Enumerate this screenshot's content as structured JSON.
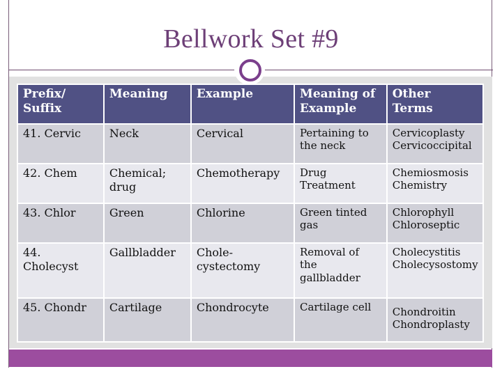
{
  "slide": {
    "title": "Bellwork Set #9",
    "accent_color": "#6d3f77",
    "header_color": "#505184",
    "footer_color": "#9c4d9f"
  },
  "table": {
    "headers": [
      [
        "Prefix/",
        "Suffix"
      ],
      [
        "Meaning"
      ],
      [
        "Example"
      ],
      [
        "Meaning of",
        "Example"
      ],
      [
        "Other",
        "Terms"
      ]
    ],
    "rows": [
      {
        "prefix": [
          "41. Cervic"
        ],
        "meaning": [
          "Neck"
        ],
        "example": [
          "Cervical"
        ],
        "meaning_of_example": [
          "Pertaining to",
          "the neck"
        ],
        "other_terms": [
          "Cervicoplasty",
          "Cervicoccipital"
        ]
      },
      {
        "prefix": [
          "42. Chem"
        ],
        "meaning": [
          "Chemical;",
          "drug"
        ],
        "example": [
          "Chemotherapy"
        ],
        "meaning_of_example": [
          "Drug",
          "Treatment"
        ],
        "other_terms": [
          "Chemiosmosis",
          "Chemistry"
        ]
      },
      {
        "prefix": [
          "43. Chlor"
        ],
        "meaning": [
          "Green"
        ],
        "example": [
          "Chlorine"
        ],
        "meaning_of_example": [
          "Green tinted",
          "gas"
        ],
        "other_terms": [
          "Chlorophyll",
          "Chloroseptic"
        ]
      },
      {
        "prefix": [
          "44.",
          "Cholecyst"
        ],
        "meaning": [
          "Gallbladder"
        ],
        "example": [
          "Chole-",
          "cystectomy"
        ],
        "meaning_of_example": [
          "Removal of",
          "the",
          "gallbladder"
        ],
        "other_terms": [
          "Cholecystitis",
          "Cholecysostomy"
        ]
      },
      {
        "prefix": [
          "45. Chondr"
        ],
        "meaning": [
          "Cartilage"
        ],
        "example": [
          "Chondrocyte"
        ],
        "meaning_of_example": [
          "Cartilage cell"
        ],
        "other_terms": [
          "Chondroitin",
          "Chondroplasty"
        ]
      }
    ]
  }
}
